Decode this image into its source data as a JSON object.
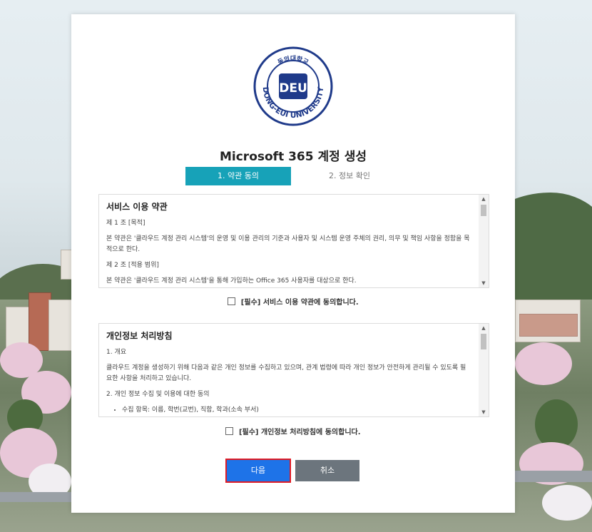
{
  "logo": {
    "university_name": "DONG-EUI UNIVERSITY",
    "korean_name": "동의대학교",
    "emblem": "DEU"
  },
  "page_title": "Microsoft 365 계정 생성",
  "steps": {
    "active": "1. 약관 동의",
    "next": "2. 정보 확인"
  },
  "terms": {
    "heading": "서비스 이용 약관",
    "lines": [
      "제 1 조 [목적]",
      "본 약관은 '클라우드 계정 관리 시스템'의 운영 및 이용 관리의 기준과 사용자 및 시스템 운영 주체의 권리, 의무 및 책임 사항을 정함을 목적으로 한다.",
      "제 2 조 [적용 범위]",
      "본 약관은 '클라우드 계정 관리 시스템'을 통해 가입하는 Office 365 사용자를 대상으로 한다."
    ],
    "agree_label": "[필수] 서비스 이용 약관에 동의합니다."
  },
  "privacy": {
    "heading": "개인정보 처리방침",
    "lines": [
      "1. 개요",
      "클라우드 계정을 생성하기 위해 다음과 같은 개인 정보를 수집하고 있으며, 관계 법령에 따라 개인 정보가 안전하게 관리될 수 있도록 필요한 사항을 처리하고 있습니다.",
      "2. 개인 정보 수집 및 이용에 대한 동의"
    ],
    "bullets": [
      "수집 항목: 이름, 학번(교번), 직함, 학과(소속 부서)"
    ],
    "agree_label": "[필수] 개인정보 처리방침에 동의합니다."
  },
  "buttons": {
    "next": "다음",
    "cancel": "취소"
  },
  "colors": {
    "step_active": "#17a2b8",
    "primary_button": "#1e73e8",
    "cancel_button": "#6c757d",
    "highlight_border": "#e01b24",
    "emblem_blue": "#1f3a8a"
  }
}
